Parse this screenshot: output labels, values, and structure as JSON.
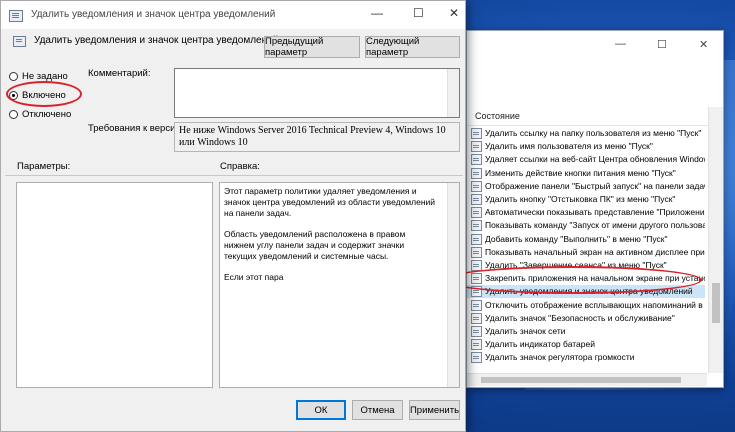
{
  "back_window": {
    "minimize_glyph": "—",
    "maximize_glyph": "☐",
    "close_glyph": "✕",
    "column_header": "Состояние",
    "policies": [
      "Удалить ссылку на папку пользователя из меню \"Пуск\"",
      "Удалить имя пользователя из меню \"Пуск\"",
      "Удаляет ссылки на веб-сайт Центра обновления Window...",
      "Изменить действие кнопки питания меню \"Пуск\"",
      "Отображение панели \"Быстрый запуск\" на панели задач",
      "Удалить кнопку \"Отстыковка ПК\" из меню \"Пуск\"",
      "Автоматически показывать представление \"Приложения...",
      "Показывать команду \"Запуск от имени другого пользова...",
      "Добавить команду \"Выполнить\" в меню \"Пуск\"",
      "Показывать начальный экран на активном дисплее при ...",
      "Удалить \"Завершение сеанса\" из меню \"Пуск\"",
      "Закрепить приложения на начальном экране при устано...",
      "Удалить уведомления и значок центра уведомлений",
      "Отключить отображение всплывающих напоминаний в ...",
      "Удалить значок \"Безопасность и обслуживание\"",
      "Удалить значок сети",
      "Удалить индикатор батарей",
      "Удалить значок регулятора громкости"
    ],
    "selected_index": 12
  },
  "dialog": {
    "title": "Удалить уведомления и значок центра уведомлений",
    "minimize_glyph": "—",
    "maximize_glyph": "☐",
    "close_glyph": "✕",
    "header_text": "Удалить уведомления и значок центра уведомлений",
    "prev_button": "Предыдущий параметр",
    "next_button": "Следующий параметр",
    "radio_not_configured": "Не задано",
    "radio_enabled": "Включено",
    "radio_disabled": "Отключено",
    "comment_label": "Комментарий:",
    "requirements_label": "Требования к версии:",
    "requirements_text": "Не ниже Windows Server 2016 Technical Preview 4, Windows 10 или Windows 10",
    "options_label": "Параметры:",
    "help_label": "Справка:",
    "help_p1": "Этот параметр политики удаляет уведомления и значок центра уведомлений из области уведомлений на панели задач.",
    "help_p2": "Область уведомлений расположена в правом нижнем углу панели задач и содержит значки текущих уведомлений и системные часы.",
    "help_p3": "Если этот пара",
    "ok_button": "ОК",
    "cancel_button": "Отмена",
    "apply_button": "Применить"
  }
}
